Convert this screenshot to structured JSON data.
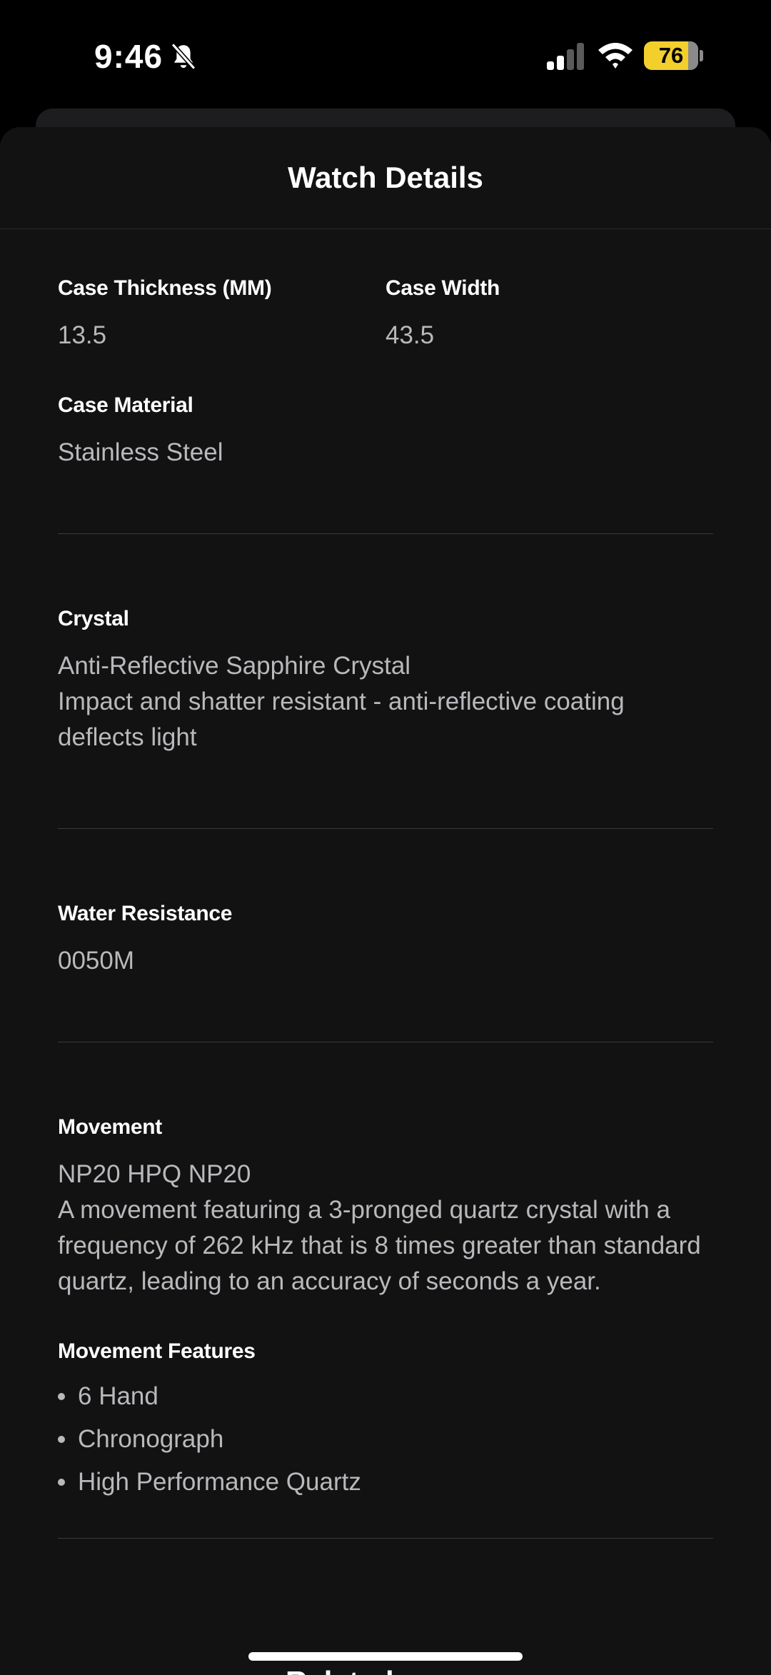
{
  "status_bar": {
    "time": "9:46",
    "battery": "76",
    "icons": [
      "bell-slash-icon",
      "cellular-signal-icon",
      "wifi-icon",
      "battery-icon"
    ],
    "battery_color": "#f2cf2b"
  },
  "sheet": {
    "title": "Watch Details"
  },
  "details": {
    "case_thickness": {
      "label": "Case Thickness (MM)",
      "value": "13.5"
    },
    "case_width": {
      "label": "Case Width",
      "value": "43.5"
    },
    "case_material": {
      "label": "Case Material",
      "value": "Stainless Steel"
    },
    "crystal": {
      "label": "Crystal",
      "value": "Anti-Reflective Sapphire Crystal",
      "description": "Impact and shatter resistant - anti-reflective coating deflects light"
    },
    "water_resistance": {
      "label": "Water Resistance",
      "value": "0050M"
    },
    "movement": {
      "label": "Movement",
      "value": "NP20 HPQ NP20",
      "description": "A movement featuring a 3-pronged quartz crystal with a frequency of 262 kHz that is 8 times greater than standard quartz, leading to an accuracy of seconds a year."
    },
    "movement_features": {
      "label": "Movement Features",
      "items": [
        "6 Hand",
        "Chronograph",
        "High Performance Quartz"
      ]
    }
  },
  "next_section_peek": "Related Watches"
}
